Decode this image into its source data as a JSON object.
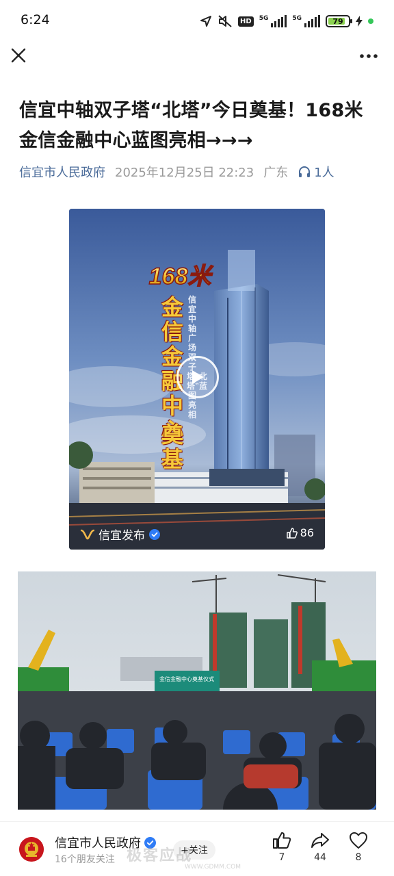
{
  "status_bar": {
    "time": "6:24",
    "hd_label": "HD",
    "signal_1_label": "5G",
    "signal_2_label": "5G",
    "battery": "79"
  },
  "nav": {
    "close_icon": "close-icon",
    "more_icon": "more-icon"
  },
  "article": {
    "title": "信宜中轴双子塔“北塔”今日奠基！168米金信金融中心蓝图亮相→→→",
    "author": "信宜市人民政府",
    "date": "2025年12月25日 22:23",
    "region": "广东",
    "listeners": "1人"
  },
  "video": {
    "overlay_height": "168米",
    "overlay_name": "金信金融中心",
    "overlay_action": "奠基",
    "overlay_subtitle": "信宜中轴广场双子塔“北塔”蓝图亮相",
    "channel": "信宜发布",
    "likes": "86"
  },
  "photo": {
    "banner": "金信金融中心奠基仪式"
  },
  "bottom_bar": {
    "account_name": "信宜市人民政府",
    "followers": "16个朋友关注",
    "follow_label": "+关注",
    "like_count": "7",
    "share_count": "44",
    "heart_count": "8",
    "watermark": "极客应战",
    "watermark_url": "WWW.GDMM.COM"
  },
  "colors": {
    "link_blue": "#4a6b99",
    "verified_blue": "#2f7cf6",
    "battery_green": "#8bd24f",
    "emblem_red": "#c8161d"
  }
}
